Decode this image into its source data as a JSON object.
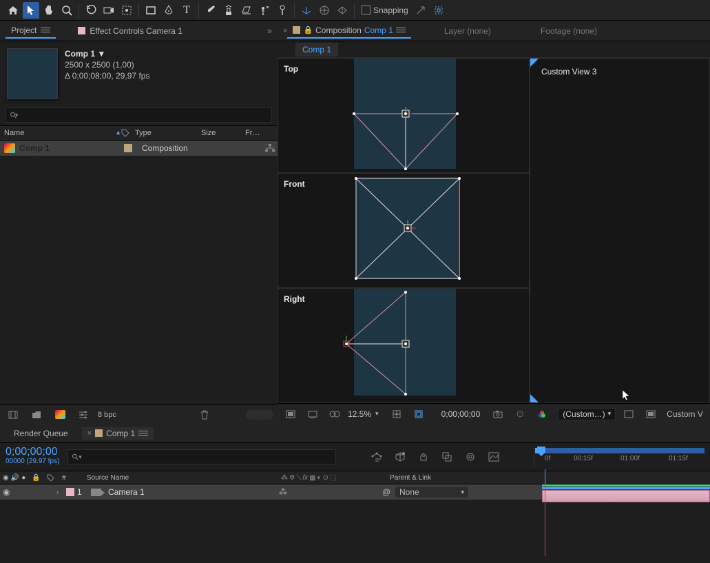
{
  "toolbar": {
    "snapping_label": "Snapping"
  },
  "project": {
    "tab_label": "Project",
    "effect_tab_label": "Effect Controls Camera 1",
    "comp_title": "Comp 1 ▼",
    "dims": "2500 x 2500 (1,00)",
    "duration": "Δ 0;00;08;00, 29,97 fps",
    "search_icon": "⚲",
    "headers": {
      "name": "Name",
      "type": "Type",
      "size": "Size",
      "fr": "Fr…"
    },
    "row": {
      "name": "Comp 1",
      "type": "Composition"
    },
    "bpc": "8 bpc"
  },
  "composition": {
    "label": "Composition",
    "name": "Comp 1",
    "layer_tab": "Layer  (none)",
    "footage_tab": "Footage  (none)",
    "views": {
      "top": "Top",
      "front": "Front",
      "right": "Right",
      "custom": "Custom View 3"
    },
    "footer": {
      "zoom": "12.5%",
      "timecode": "0;00;00;00",
      "view_menu": "(Custom…)",
      "last": "Custom V"
    }
  },
  "timeline": {
    "render_queue": "Render Queue",
    "comp_tab": "Comp 1",
    "timecode": "0;00;00;00",
    "frames": "00000 (29.97 fps)",
    "headers": {
      "num": "#",
      "source": "Source Name",
      "parent": "Parent & Link"
    },
    "layer": {
      "num": "1",
      "name": "Camera 1",
      "parent": "None"
    },
    "ruler": [
      "0f",
      "00:15f",
      "01:00f",
      "01:15f"
    ]
  }
}
